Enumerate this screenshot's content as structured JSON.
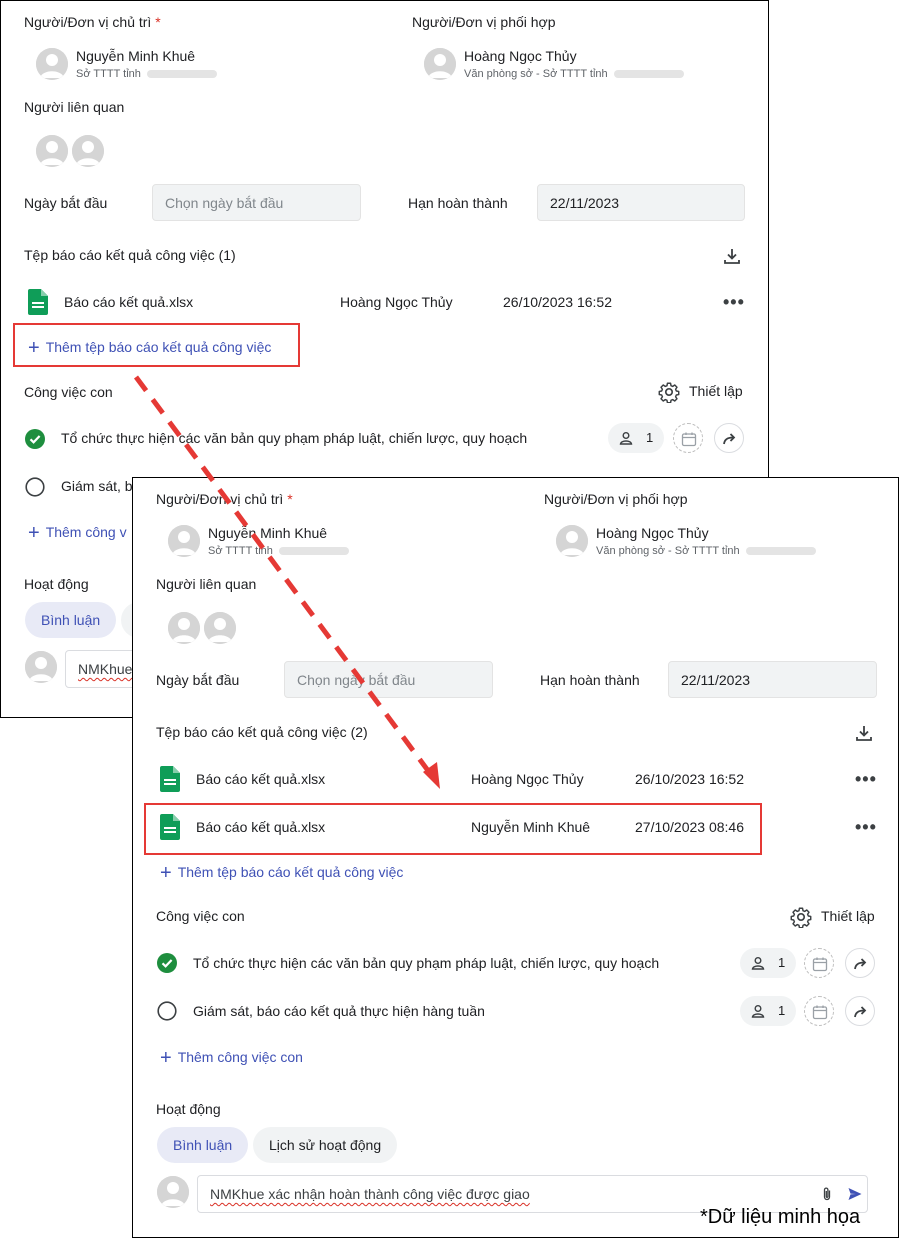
{
  "back": {
    "main_person_label": "Người/Đơn vị chủ trì",
    "required_mark": "*",
    "coop_label": "Người/Đơn vị phối hợp",
    "main_person": {
      "name": "Nguyễn Minh Khuê",
      "unit": "Sở TTTT tỉnh"
    },
    "coop_person": {
      "name": "Hoàng Ngọc Thủy",
      "unit": "Văn phòng sở - Sở TTTT tỉnh"
    },
    "related_label": "Người liên quan",
    "start_label": "Ngày bắt đầu",
    "start_placeholder": "Chọn ngày bắt đầu",
    "deadline_label": "Hạn hoàn thành",
    "deadline_value": "22/11/2023",
    "files_title": "Tệp báo cáo kết quả công việc (1)",
    "files": [
      {
        "name": "Báo cáo kết quả.xlsx",
        "uploader": "Hoàng Ngọc Thủy",
        "time": "26/10/2023 16:52"
      }
    ],
    "add_file": "Thêm tệp báo cáo kết quả công việc",
    "subtasks_label": "Công việc con",
    "settings_label": "Thiết lập",
    "subtasks": [
      {
        "text": "Tổ chức thực hiện các văn bản quy phạm pháp luật, chiến lược, quy hoạch",
        "count": "1"
      },
      {
        "text": "Giám sát, b"
      }
    ],
    "add_subtask": "Thêm công v",
    "activity_label": "Hoạt động",
    "tab_comment": "Bình luận",
    "comment_text": "NMKhue"
  },
  "front": {
    "main_person_label": "Người/Đơn vị chủ trì",
    "required_mark": "*",
    "coop_label": "Người/Đơn vị phối hợp",
    "main_person": {
      "name": "Nguyễn Minh Khuê",
      "unit": "Sở TTTT tỉnh"
    },
    "coop_person": {
      "name": "Hoàng Ngọc Thủy",
      "unit": "Văn phòng sở - Sở TTTT tỉnh"
    },
    "related_label": "Người liên quan",
    "start_label": "Ngày bắt đầu",
    "start_placeholder": "Chọn ngày bắt đầu",
    "deadline_label": "Hạn hoàn thành",
    "deadline_value": "22/11/2023",
    "files_title": "Tệp báo cáo kết quả công việc (2)",
    "files": [
      {
        "name": "Báo cáo kết quả.xlsx",
        "uploader": "Hoàng Ngọc Thủy",
        "time": "26/10/2023 16:52"
      },
      {
        "name": "Báo cáo kết quả.xlsx",
        "uploader": "Nguyễn Minh Khuê",
        "time": "27/10/2023 08:46"
      }
    ],
    "add_file": "Thêm tệp báo cáo kết quả công việc",
    "subtasks_label": "Công việc con",
    "settings_label": "Thiết lập",
    "subtasks": [
      {
        "text": "Tổ chức thực hiện các văn bản quy phạm pháp luật, chiến lược, quy hoạch",
        "count": "1",
        "done": true
      },
      {
        "text": "Giám sát, báo cáo kết quả thực hiện hàng tuần",
        "count": "1",
        "done": false
      }
    ],
    "add_subtask": "Thêm công việc con",
    "activity_label": "Hoạt động",
    "tab_comment": "Bình luận",
    "tab_history": "Lịch sử hoạt động",
    "comment_text": "NMKhue xác nhận hoàn thành công việc được giao"
  },
  "footnote": "*Dữ liệu minh họa",
  "colors": {
    "accent": "#3f51b5",
    "success": "#1e8e3e",
    "highlight": "#e53935",
    "file_green": "#0f9d58"
  }
}
